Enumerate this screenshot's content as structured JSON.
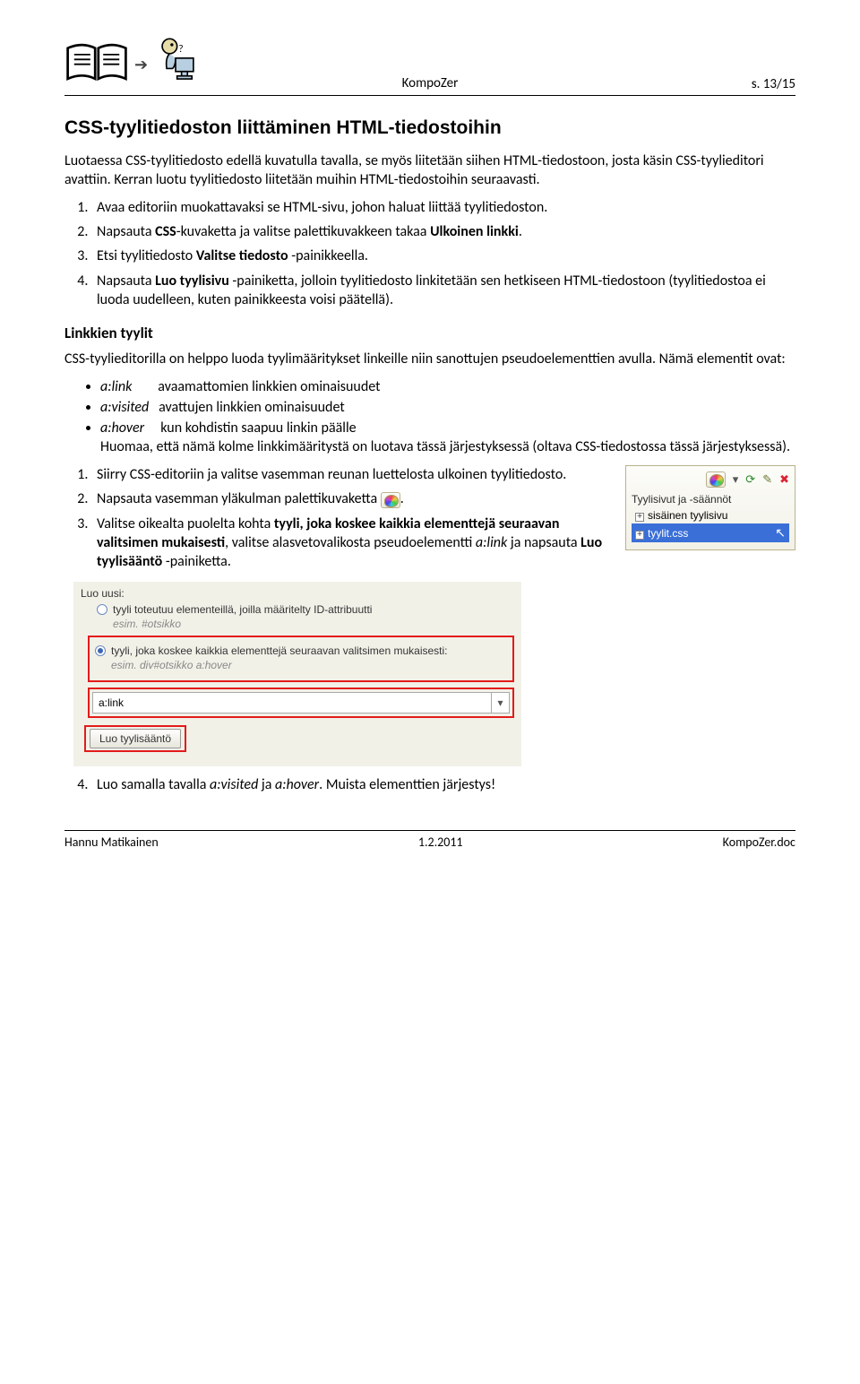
{
  "header": {
    "center": "KompoZer",
    "right": "s. 13/15"
  },
  "h1": "CSS-tyylitiedoston liittäminen HTML-tiedostoihin",
  "intro": "Luotaessa CSS-tyylitiedosto edellä kuvatulla tavalla, se myös liitetään siihen HTML-tiedostoon, josta käsin CSS-tyylieditori avattiin. Kerran luotu tyylitiedosto liitetään muihin HTML-tiedostoihin seuraavasti.",
  "listA": {
    "i1": "Avaa editoriin muokattavaksi se HTML-sivu, johon haluat liittää tyylitiedoston.",
    "i2_a": "Napsauta ",
    "i2_b": "CSS",
    "i2_c": "-kuvaketta ja valitse palettikuvakkeen takaa ",
    "i2_d": "Ulkoinen linkki",
    "i2_e": ".",
    "i3_a": "Etsi tyylitiedosto ",
    "i3_b": "Valitse tiedosto",
    "i3_c": " -painikkeella.",
    "i4_a": "Napsauta ",
    "i4_b": "Luo tyylisivu",
    "i4_c": " -painiketta, jolloin tyylitiedosto linkitetään sen hetkiseen HTML-tiedostoon (tyylitiedostoa ei luoda uudelleen, kuten painikkeesta voisi päätellä)."
  },
  "h2": "Linkkien tyylit",
  "p2": "CSS-tyylieditorilla on helppo luoda tyylimääritykset linkeille niin sanottujen pseudoelementtien avulla. Nämä elementit ovat:",
  "bullets": {
    "b1_a": "a:link",
    "b1_b": "avaamattomien linkkien ominaisuudet",
    "b2_a": "a:visited",
    "b2_b": "avattujen linkkien ominaisuudet",
    "b3_a": "a:hover",
    "b3_b": "kun kohdistin saapuu linkin päälle",
    "note": "Huomaa, että nämä kolme linkkimääritystä on luotava tässä järjestyksessä (oltava CSS-tiedostossa tässä järjestyksessä)."
  },
  "panel": {
    "title": "Tyylisivut ja -säännöt",
    "item1": "sisäinen tyylisivu",
    "item2": "tyylit.css"
  },
  "listB": {
    "i1": "Siirry CSS-editoriin ja valitse vasemman reunan luettelosta ulkoinen tyylitiedosto.",
    "i2_a": "Napsauta vasemman yläkulman palettikuvaketta ",
    "i2_b": ".",
    "i3_a": "Valitse oikealta puolelta kohta ",
    "i3_b": "tyyli, joka koskee kaikkia elementtejä seuraavan valitsimen mukaisesti",
    "i3_c": ", valitse alasvetovalikosta pseudoelementti ",
    "i3_d": "a:link",
    "i3_e": " ja napsauta ",
    "i3_f": "Luo tyylisääntö",
    "i3_g": " -painiketta."
  },
  "dialog": {
    "top": "Luo uusi:",
    "opt1": "tyyli toteutuu elementeillä, joilla määritelty ID-attribuutti",
    "hint1": "esim. #otsikko",
    "opt2": "tyyli, joka koskee kaikkia elementtejä seuraavan valitsimen mukaisesti:",
    "hint2": "esim. div#otsikko a:hover",
    "input": "a:link",
    "button": "Luo tyylisääntö"
  },
  "listC": {
    "i4_a": "Luo samalla tavalla ",
    "i4_b": "a:visited",
    "i4_c": " ja ",
    "i4_d": "a:hover",
    "i4_e": ". Muista elementtien järjestys!"
  },
  "footer": {
    "left": "Hannu Matikainen",
    "center": "1.2.2011",
    "right": "KompoZer.doc"
  }
}
